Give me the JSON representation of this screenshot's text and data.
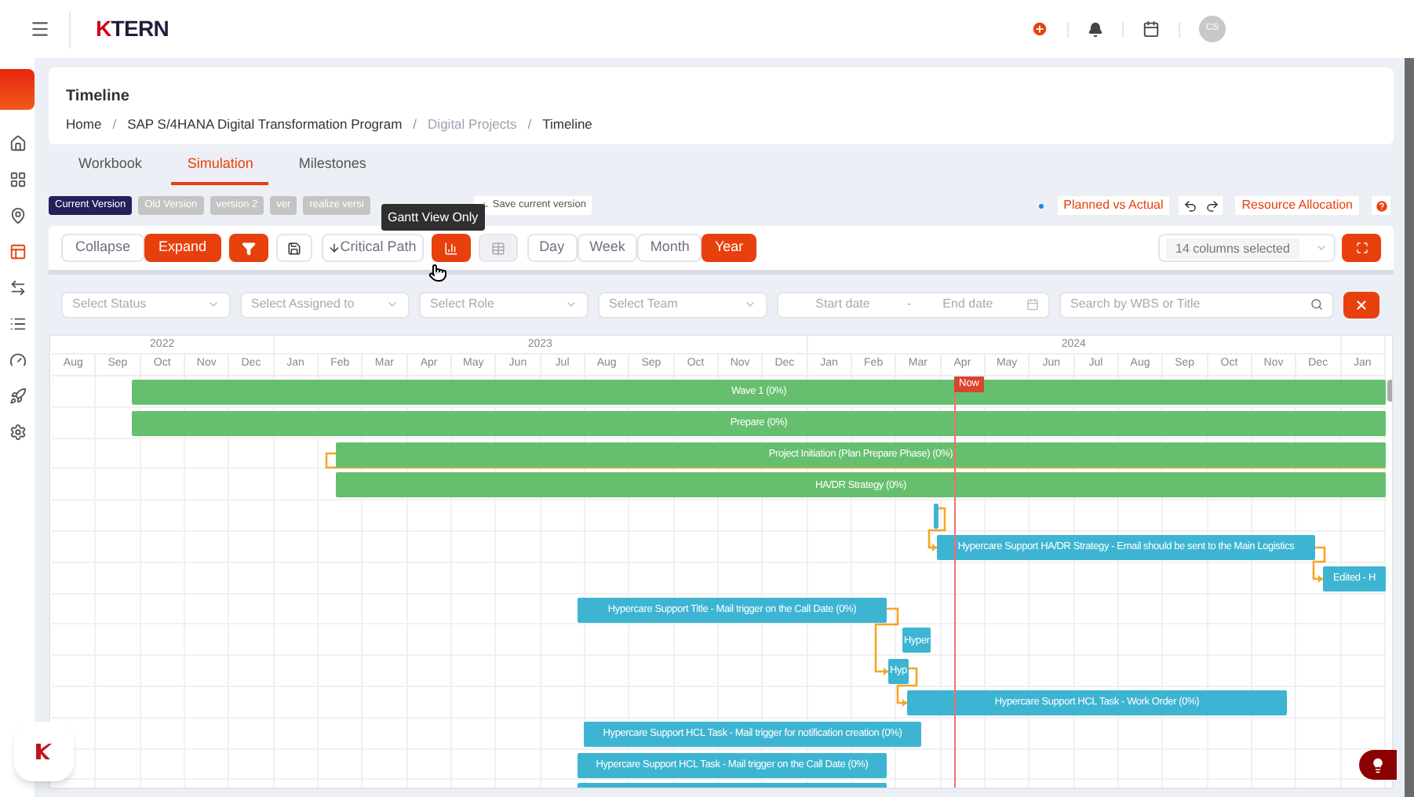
{
  "app": {
    "logo": "KTERN",
    "user_initials": "CS"
  },
  "page": {
    "title": "Timeline",
    "separator": "/",
    "breadcrumb": [
      {
        "label": "Home",
        "muted": false
      },
      {
        "label": "SAP S/4HANA Digital Transformation Program",
        "muted": false
      },
      {
        "label": "Digital Projects",
        "muted": true
      },
      {
        "label": "Timeline",
        "muted": false
      }
    ]
  },
  "tabs": [
    {
      "label": "Workbook",
      "selected": false
    },
    {
      "label": "Simulation",
      "selected": true
    },
    {
      "label": "Milestones",
      "selected": false
    }
  ],
  "versions": [
    {
      "label": "Current Version",
      "selected": true
    },
    {
      "label": "Old Version",
      "selected": false
    },
    {
      "label": "version 2",
      "selected": false
    },
    {
      "label": "ver",
      "selected": false
    },
    {
      "label": "realize versi",
      "selected": false
    }
  ],
  "save_version": "Save current version",
  "tooltip": "Gantt View Only",
  "actions": {
    "planned_vs_actual": "Planned vs Actual",
    "resource_allocation": "Resource Allocation"
  },
  "toolbar": {
    "expand_toggle": [
      {
        "label": "Collapse",
        "selected": false
      },
      {
        "label": "Expand",
        "selected": true
      }
    ],
    "critical_path": "Critical Path",
    "views": [
      {
        "kind": "chart",
        "selected": true
      },
      {
        "kind": "table",
        "selected": false
      }
    ],
    "scales": [
      {
        "label": "Day",
        "selected": false
      },
      {
        "label": "Week",
        "selected": false
      },
      {
        "label": "Month",
        "selected": false
      },
      {
        "label": "Year",
        "selected": true
      }
    ],
    "columns_select": "14 columns selected"
  },
  "filters": {
    "selects": [
      {
        "placeholder": "Select Status"
      },
      {
        "placeholder": "Select Assigned to"
      },
      {
        "placeholder": "Select Role"
      },
      {
        "placeholder": "Select Team"
      }
    ],
    "start_date": "Start date",
    "range_separator": "-",
    "end_date": "End date",
    "search": "Search by WBS or Title"
  },
  "gantt": {
    "years": [
      {
        "label": "2022"
      },
      {
        "label": "2023"
      },
      {
        "label": "2024"
      }
    ],
    "months": [
      "Aug",
      "Sep",
      "Oct",
      "Nov",
      "Dec",
      "Jan",
      "Feb",
      "Mar",
      "Apr",
      "May",
      "Jun",
      "Jul",
      "Aug",
      "Sep",
      "Oct",
      "Nov",
      "Dec",
      "Jan",
      "Feb",
      "Mar",
      "Apr",
      "May",
      "Jun",
      "Jul",
      "Aug",
      "Sep",
      "Oct",
      "Nov",
      "Dec",
      "Jan"
    ],
    "now_label": "Now",
    "tasks": [
      {
        "label": "Wave 1 (0%)",
        "color": "#66bf6e"
      },
      {
        "label": "Prepare (0%)",
        "color": "#66bf6e"
      },
      {
        "label": "Project Initiation (Plan Prepare Phase) (0%)",
        "color": "#66bf6e"
      },
      {
        "label": "HA/DR Strategy (0%)",
        "color": "#66bf6e"
      },
      {
        "color": "#3db5d2"
      },
      {
        "label": "Hypercare Support HA/DR Strategy - Email should be sent to the Main Logistics",
        "color": "#3db5d2"
      },
      {
        "label": "Edited - H",
        "color": "#3db5d2"
      },
      {
        "label": "Hypercare Support Title - Mail trigger on the Call Date (0%)",
        "color": "#3db5d2"
      },
      {
        "label": "Hyper",
        "color": "#3db5d2"
      },
      {
        "label": "Hyp",
        "color": "#3db5d2"
      },
      {
        "label": "Hypercare Support HCL Task - Work Order (0%)",
        "color": "#3db5d2"
      },
      {
        "label": "Hypercare Support HCL Task - Mail trigger for notification creation (0%)",
        "color": "#3db5d2"
      },
      {
        "label": "Hypercare Support HCL Task - Mail trigger on the Call Date (0%)",
        "color": "#3db5d2"
      },
      {
        "color": "#3db5d2"
      }
    ]
  }
}
